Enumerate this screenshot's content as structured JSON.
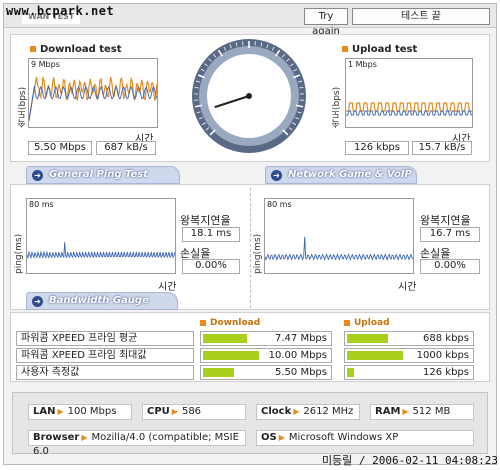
{
  "watermark": "www.bcpark.net",
  "window": {
    "tab_label": "WAN TEST"
  },
  "toolbar": {
    "try_again": "Try again",
    "end_test": "테스트 끝"
  },
  "download": {
    "title": "Download test",
    "ylabel": "속도(bps)",
    "scale": "9 Mbps",
    "time_label": "시간",
    "mbps": "5.50 Mbps",
    "kbs": "687 kB/s",
    "color": "#e58a1d"
  },
  "upload": {
    "title": "Upload test",
    "ylabel": "속도(bps)",
    "scale": "1 Mbps",
    "time_label": "시간",
    "kbps": "126 kbps",
    "kbs": "15.7 kB/s"
  },
  "gauge": {
    "needle_fraction": 0.1,
    "icon": "speedometer-icon"
  },
  "ping": {
    "tab_label": "General Ping Test",
    "ylabel": "ping(ms)",
    "scale": "80 ms",
    "time_label": "시간",
    "rtt_label": "왕복지연율",
    "rtt_value": "18.1 ms",
    "loss_label": "손실율",
    "loss_value": "0.00%"
  },
  "game": {
    "tab_label": "Network Game & VoIP Test",
    "ylabel": "ping(ms)",
    "scale": "80 ms",
    "time_label": "시간",
    "rtt_label": "왕복지연율",
    "rtt_value": "16.7 ms",
    "loss_label": "손실율",
    "loss_value": "0.00%"
  },
  "bandwidth": {
    "tab_label": "Bandwidth Gauge",
    "download_header": "Download",
    "upload_header": "Upload",
    "bar_color": "#a8cf1a",
    "rows": [
      {
        "label": "파워콤 XPEED 프라임 평균",
        "down": "7.47 Mbps",
        "down_fill": 0.74,
        "up": "688 kbps",
        "up_fill": 0.69
      },
      {
        "label": "파워콤 XPEED 프라임 최대값",
        "down": "10.00 Mbps",
        "down_fill": 0.94,
        "up": "1000 kbps",
        "up_fill": 0.94
      },
      {
        "label": "사용자 측정값",
        "down": "5.50 Mbps",
        "down_fill": 0.52,
        "up": "126 kbps",
        "up_fill": 0.12
      }
    ]
  },
  "sysinfo": {
    "lan_label": "LAN",
    "lan_value": "100 Mbps",
    "cpu_label": "CPU",
    "cpu_value": "586",
    "clock_label": "Clock",
    "clock_value": "2612 MHz",
    "ram_label": "RAM",
    "ram_value": "512 MB",
    "browser_label": "Browser",
    "browser_value": "Mozilla/4.0 (compatible; MSIE 6.0",
    "os_label": "OS",
    "os_value": "Microsoft Windows XP"
  },
  "footer": "미등릴 / 2006-02-11 04:08:23"
}
